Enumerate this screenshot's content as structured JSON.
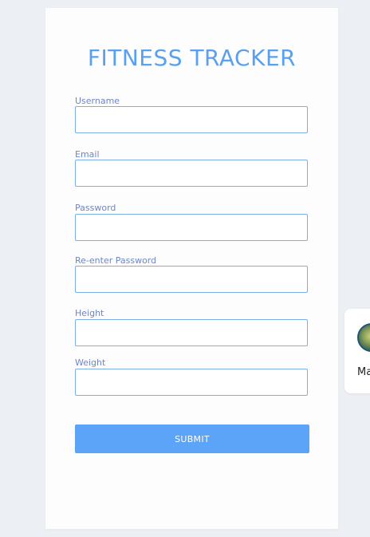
{
  "form": {
    "title": "FITNESS TRACKER",
    "fields": [
      {
        "label": "Username",
        "value": "",
        "placeholder": ""
      },
      {
        "label": "Email",
        "value": "",
        "placeholder": ""
      },
      {
        "label": "Password",
        "value": "",
        "placeholder": ""
      },
      {
        "label": "Re-enter Password",
        "value": "",
        "placeholder": ""
      },
      {
        "label": "Height",
        "value": "",
        "placeholder": ""
      },
      {
        "label": "Weight",
        "value": "",
        "placeholder": ""
      }
    ],
    "submit_label": "SUBMIT"
  },
  "side_widget": {
    "text": "Ma"
  },
  "colors": {
    "accent": "#5b9fef",
    "button": "#5ba4f8",
    "label": "#6f86c4",
    "field_border": "#7eaee8",
    "background": "#eceff3"
  }
}
